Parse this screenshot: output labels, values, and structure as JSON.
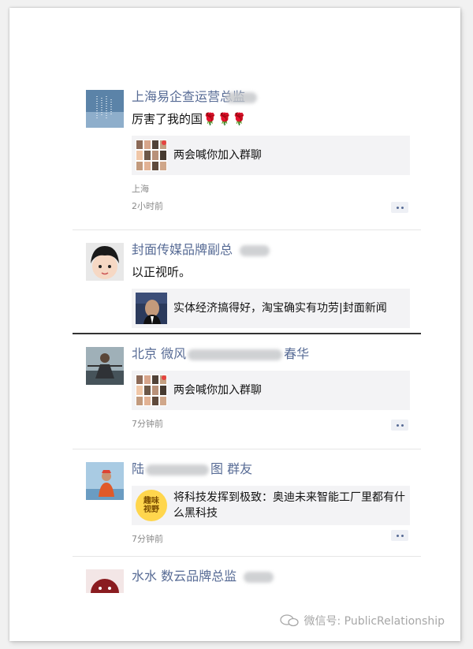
{
  "posts": [
    {
      "name": "上海易企查运营总监",
      "text": "厉害了我的国🌹🌹🌹",
      "share": "两会喊你加入群聊",
      "location": "上海",
      "time": "2小时前"
    },
    {
      "name": "封面传媒品牌副总",
      "text": "以正视听。",
      "share": "实体经济搞得好，淘宝确实有功劳|封面新闻"
    },
    {
      "name_left": "北京 微风",
      "name_right": "春华",
      "share": "两会喊你加入群聊",
      "time": "7分钟前"
    },
    {
      "name_left": "陆",
      "name_right": "图 群友",
      "share": "将科技发挥到极致：奥迪未来智能工厂里都有什么黑科技",
      "share_logo": [
        "趣味",
        "视野"
      ],
      "time": "7分钟前"
    },
    {
      "name": "水水 数云品牌总监"
    }
  ],
  "watermark": "微信号: PublicRelationship",
  "colors": {
    "name": "#576b95",
    "meta": "#8a8a8a",
    "share_bg": "#f3f3f5"
  }
}
